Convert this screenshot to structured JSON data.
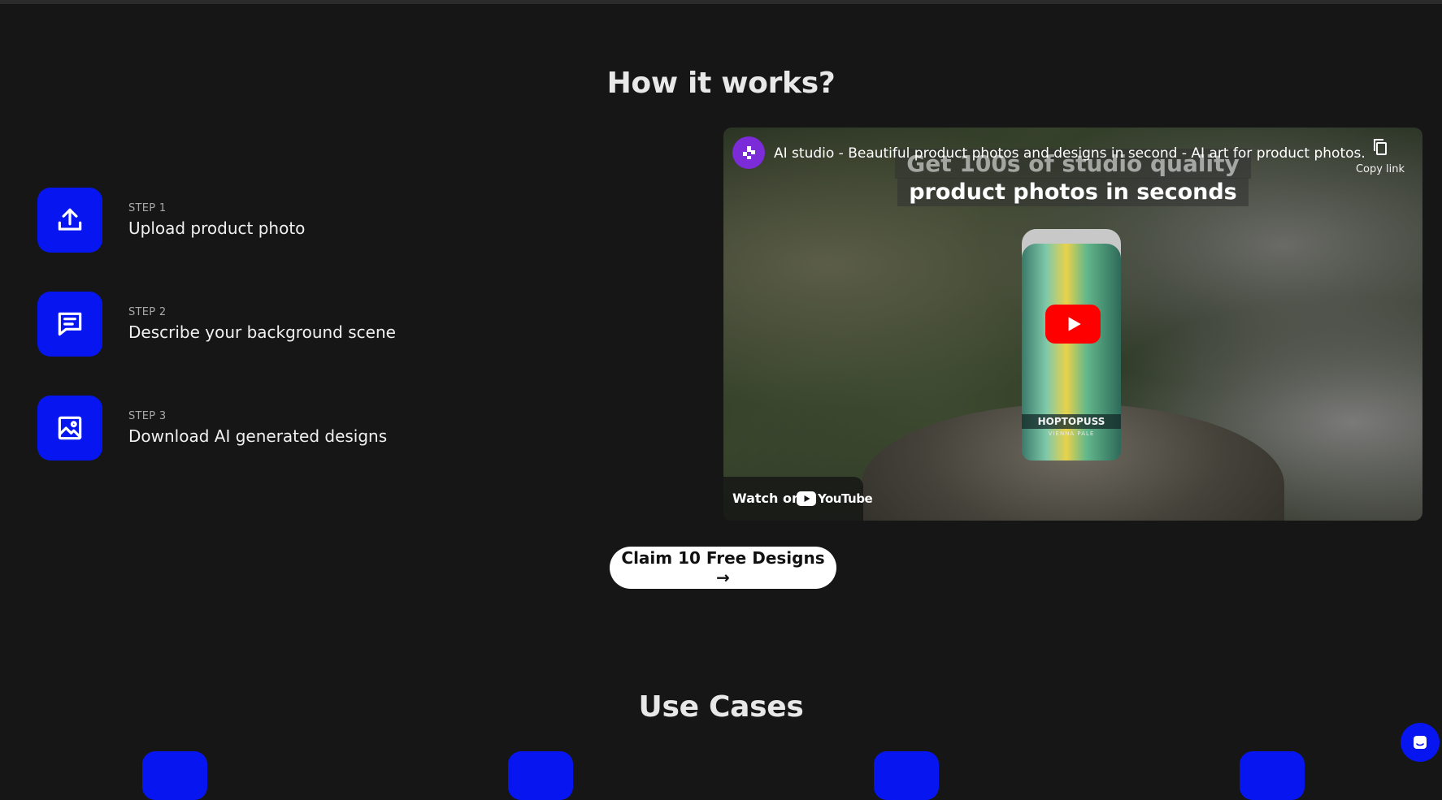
{
  "how_it_works": {
    "title": "How it works?",
    "steps": [
      {
        "label": "STEP 1",
        "text": "Upload product photo",
        "icon": "upload-icon"
      },
      {
        "label": "STEP 2",
        "text": "Describe your background scene",
        "icon": "message-icon"
      },
      {
        "label": "STEP 3",
        "text": "Download AI generated designs",
        "icon": "image-icon"
      }
    ]
  },
  "video": {
    "title": "AI studio - Beautiful product photos and designs in second - AI art for product photos.",
    "copy_link_label": "Copy link",
    "overlay_line1": "Get 100s of studio quality",
    "overlay_line2": "product photos in seconds",
    "can_label": "HOPTOPUSS",
    "can_sub": "VIENNA PALE",
    "watch_on_label": "Watch on",
    "youtube_word": "YouTube"
  },
  "cta": {
    "label": "Claim 10 Free Designs →"
  },
  "use_cases": {
    "title": "Use Cases"
  },
  "colors": {
    "background": "#161616",
    "accent_blue": "#0716f0",
    "youtube_red": "#ff0000",
    "cta_background": "#ffffff"
  }
}
